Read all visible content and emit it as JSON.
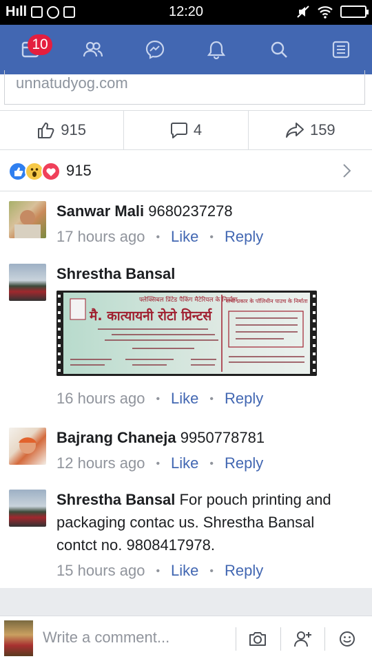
{
  "status_bar": {
    "signal_text": "Hıll",
    "time": "12:20"
  },
  "nav": {
    "notification_count": "10",
    "icons": [
      "news-feed-icon",
      "friends-icon",
      "messenger-icon",
      "notifications-icon",
      "search-icon",
      "menu-icon"
    ],
    "accent": "#4267b2"
  },
  "link_preview": {
    "domain": "unnatudyog.com"
  },
  "actions": {
    "likes": "915",
    "comments": "4",
    "shares": "159"
  },
  "reactions": {
    "count": "915"
  },
  "comments": [
    {
      "author": "Sanwar Mali",
      "text": "9680237278",
      "time": "17 hours ago",
      "like_label": "Like",
      "reply_label": "Reply"
    },
    {
      "author": "Shrestha Bansal",
      "text": "",
      "time": "16 hours ago",
      "like_label": "Like",
      "reply_label": "Reply",
      "attachment": {
        "heading_left": "फ्लेक्सिबल प्रिंटेड पैकिंग मैटेरियल के निर्माता",
        "business_name": "मै. कात्यायनी रोटो प्रिन्टर्स",
        "heading_right": "सभी प्रकार के पॉलिथीन पाउच के निर्माता"
      }
    },
    {
      "author": "Bajrang Chaneja",
      "text": "9950778781",
      "time": "12 hours ago",
      "like_label": "Like",
      "reply_label": "Reply"
    },
    {
      "author": "Shrestha Bansal",
      "text": "For pouch printing and packaging  contac us. Shrestha Bansal contct no. 9808417978.",
      "time": "15 hours ago",
      "like_label": "Like",
      "reply_label": "Reply"
    }
  ],
  "composer": {
    "placeholder": "Write a comment..."
  }
}
